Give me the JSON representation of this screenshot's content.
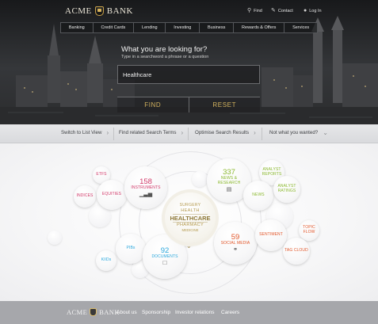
{
  "brand": {
    "left": "ACME",
    "right": "BANK"
  },
  "utility": {
    "find": "Find",
    "contact": "Contact",
    "login": "Log In"
  },
  "nav": [
    "Banking",
    "Credit Cards",
    "Lending",
    "Investing",
    "Business",
    "Rewards & Offers",
    "Services"
  ],
  "search": {
    "heading": "What you are looking for?",
    "hint": "Type in a searchword a phrase or a question",
    "value": "Healthcare",
    "find_label": "FIND",
    "reset_label": "RESET"
  },
  "actions": [
    "Switch to List View",
    "Find related Search Terms",
    "Optimise Search Results",
    "Not what you wanted?"
  ],
  "center": {
    "above": "SURGERY",
    "top": "HEALTH",
    "main": "HEALTHCARE",
    "bottom": "PHARMACY",
    "below": "MEDICINE"
  },
  "bubbles": {
    "etfs": "ETFs",
    "indices": "INDICES",
    "equities": "EQUITIES",
    "instruments_count": "158",
    "instruments": "INSTRUMENTS",
    "news_count": "337",
    "news_research": "NEWS & RESEARCH",
    "analyst_reports": "ANALYST REPORTS",
    "news": "NEWS",
    "analyst_ratings": "ANALYST RATINGS",
    "social_count": "59",
    "social_media": "SOCIAL MEDIA",
    "sentiment": "SENTIMENT",
    "topic_flow": "TOPIC FLOW",
    "tag_cloud": "TAG CLOUD",
    "pibs": "PIBs",
    "documents_count": "92",
    "documents": "DOCUMENTS",
    "kids": "KIIDs"
  },
  "colors": {
    "accent_gold": "#c9a24a",
    "pink": "#d23a6a",
    "green": "#8ab82e",
    "orange": "#e2572a",
    "blue": "#2aa7dd"
  },
  "footer": {
    "about": "About us",
    "sponsorship": "Sponsorship",
    "investor": "Investor relations",
    "careers": "Careers"
  }
}
